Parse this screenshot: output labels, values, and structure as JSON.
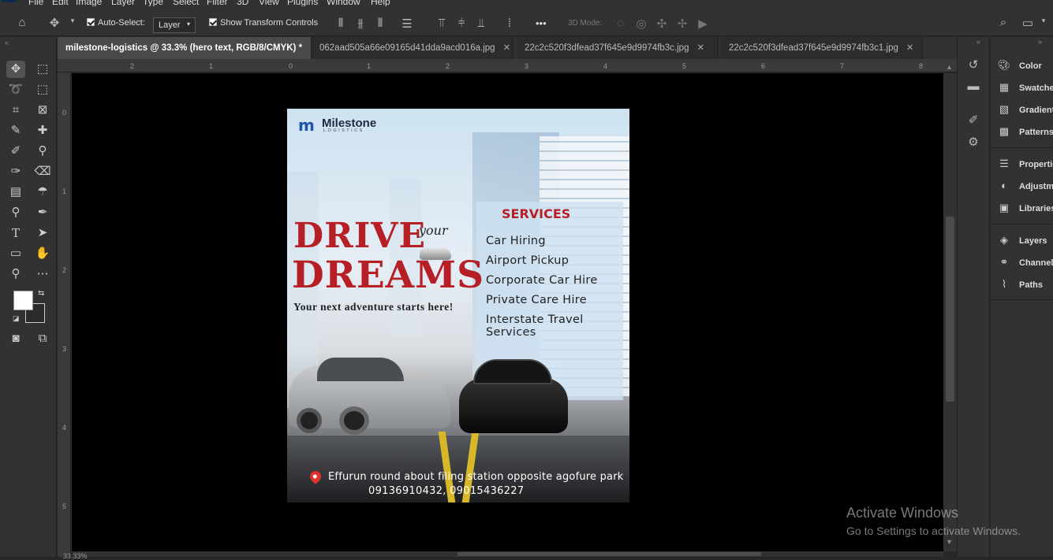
{
  "menu": [
    "File",
    "Edit",
    "Image",
    "Layer",
    "Type",
    "Select",
    "Filter",
    "3D",
    "View",
    "Plugins",
    "Window",
    "Help"
  ],
  "options": {
    "auto_select_label": "Auto-Select:",
    "auto_select_value": "Layer",
    "show_transform_label": "Show Transform Controls",
    "mode_3d_label": "3D Mode:",
    "more_label": "•••"
  },
  "tabs": [
    {
      "label": "milestone-logistics @ 33.3% (hero text, RGB/8/CMYK) *"
    },
    {
      "label": "062aad505a66e09165d41dda9acd016a.jpg"
    },
    {
      "label": "22c2c520f3dfead37f645e9d9974fb3c.jpg"
    },
    {
      "label": "22c2c520f3dfead37f645e9d9974fb3c1.jpg"
    }
  ],
  "ruler_h": [
    "2",
    "1",
    "0",
    "1",
    "2",
    "3",
    "4",
    "5",
    "6",
    "7",
    "8"
  ],
  "ruler_v": [
    "0",
    "1",
    "2",
    "3",
    "4",
    "5"
  ],
  "colors": {
    "foreground": "#ffffff",
    "background": "#2b2b2b",
    "accent_red": "#b51f25",
    "logo_blue": "#1f55a8"
  },
  "poster": {
    "logo_name": "Milestone",
    "logo_sub": "LOGISTICS",
    "headline_1": "DRIVE",
    "headline_your": "your",
    "headline_2": "DREAMS",
    "tagline": "Your next adventure starts here!",
    "services_title": "SERVICES",
    "services": [
      "Car Hiring",
      "Airport Pickup",
      "Corporate Car Hire",
      "Private Care Hire",
      "Interstate Travel Services"
    ],
    "address": "Effurun round about filing station opposite agofure park",
    "phones": "09136910432, 09015436227"
  },
  "panels": [
    "Color",
    "Swatches",
    "Gradients",
    "Patterns",
    "Properties",
    "Adjustments",
    "Libraries",
    "Layers",
    "Channels",
    "Paths"
  ],
  "watermark": {
    "title": "Activate Windows",
    "subtitle": "Go to Settings to activate Windows."
  },
  "status": {
    "zoom": "33.33%"
  }
}
